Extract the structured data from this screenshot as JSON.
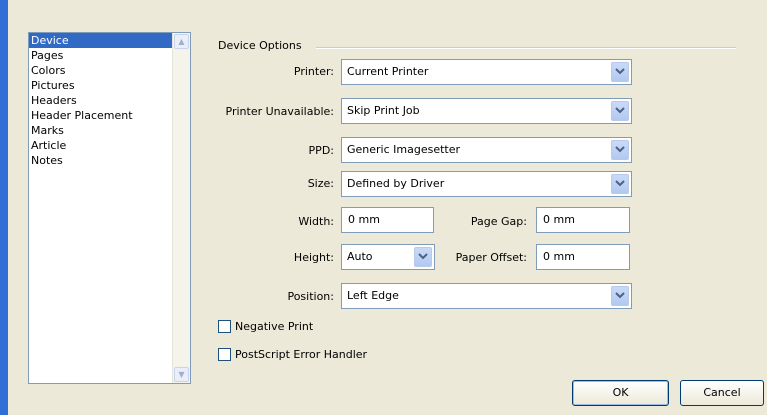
{
  "list": {
    "items": [
      "Device",
      "Pages",
      "Colors",
      "Pictures",
      "Headers",
      "Header Placement",
      "Marks",
      "Article",
      "Notes"
    ],
    "selected": "Device"
  },
  "group": {
    "title": "Device Options"
  },
  "fields": {
    "printer": {
      "label": "Printer:",
      "value": "Current Printer"
    },
    "printer_unavailable": {
      "label": "Printer Unavailable:",
      "value": "Skip Print Job"
    },
    "ppd": {
      "label": "PPD:",
      "value": "Generic Imagesetter"
    },
    "size": {
      "label": "Size:",
      "value": "Defined by Driver"
    },
    "width": {
      "label": "Width:",
      "value": "0 mm"
    },
    "page_gap": {
      "label": "Page Gap:",
      "value": "0 mm"
    },
    "height": {
      "label": "Height:",
      "value": "Auto"
    },
    "paper_offset": {
      "label": "Paper Offset:",
      "value": "0 mm"
    },
    "position": {
      "label": "Position:",
      "value": "Left Edge"
    }
  },
  "checkboxes": {
    "negative_print": {
      "label": "Negative Print",
      "checked": false
    },
    "postscript_error_handler": {
      "label": "PostScript Error Handler",
      "checked": false
    }
  },
  "buttons": {
    "ok": "OK",
    "cancel": "Cancel"
  },
  "colors": {
    "accent": "#316ac5",
    "face": "#ece9d8",
    "border": "#7f9db9"
  }
}
